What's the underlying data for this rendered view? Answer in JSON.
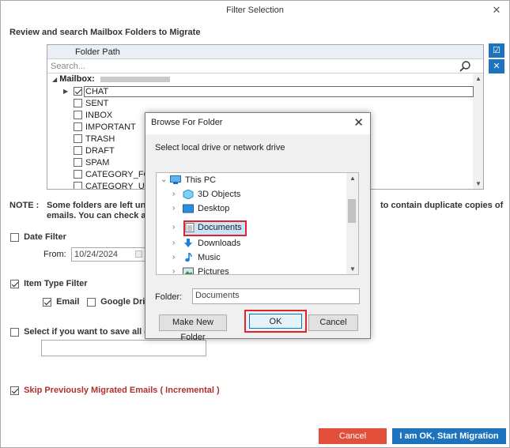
{
  "window": {
    "title": "Filter Selection",
    "close_glyph": "✕"
  },
  "section_title": "Review and search Mailbox Folders to Migrate",
  "tree": {
    "header": "Folder Path",
    "search_placeholder": "Search...",
    "mailbox_label": "Mailbox:",
    "folders": [
      {
        "name": "CHAT",
        "checked": true,
        "expandable": true
      },
      {
        "name": "SENT",
        "checked": false
      },
      {
        "name": "INBOX",
        "checked": false
      },
      {
        "name": "IMPORTANT",
        "checked": false
      },
      {
        "name": "TRASH",
        "checked": false
      },
      {
        "name": "DRAFT",
        "checked": false
      },
      {
        "name": "SPAM",
        "checked": false
      },
      {
        "name": "CATEGORY_FOR",
        "checked": false
      },
      {
        "name": "CATEGORY_UPD",
        "checked": false
      }
    ]
  },
  "side_buttons": {
    "check_all": "☑",
    "uncheck_all": "✕"
  },
  "note": {
    "label": "NOTE :",
    "line1_start": "Some folders are left unche",
    "line1_end": "to contain duplicate copies of",
    "line2": "emails. You can check and i"
  },
  "date_filter": {
    "label": "Date Filter",
    "checked": false,
    "from_label": "From:",
    "from_value": "10/24/2024"
  },
  "item_type_filter": {
    "label": "Item Type Filter",
    "checked": true,
    "email_label": "Email",
    "email_checked": true,
    "drive_label": "Google Drive",
    "drive_checked": false
  },
  "save_all": {
    "label": "Select if you want to save all data",
    "checked": false,
    "value": ""
  },
  "skip": {
    "label": "Skip Previously Migrated Emails ( Incremental )",
    "checked": true
  },
  "footer": {
    "cancel_label": "Cancel",
    "start_label": "I am OK, Start Migration"
  },
  "dialog": {
    "title": "Browse For Folder",
    "close_glyph": "✕",
    "subtitle": "Select local drive or network drive",
    "items": [
      {
        "label": "This PC",
        "icon": "this-pc-icon",
        "expanded": true,
        "level": 0
      },
      {
        "label": "3D Objects",
        "icon": "3d-objects-icon",
        "level": 1
      },
      {
        "label": "Desktop",
        "icon": "desktop-icon",
        "level": 1
      },
      {
        "label": "Documents",
        "icon": "documents-icon",
        "level": 1,
        "selected": true
      },
      {
        "label": "Downloads",
        "icon": "downloads-icon",
        "level": 1
      },
      {
        "label": "Music",
        "icon": "music-icon",
        "level": 1
      },
      {
        "label": "Pictures",
        "icon": "pictures-icon",
        "level": 1
      }
    ],
    "folder_label": "Folder:",
    "folder_value": "Documents",
    "make_new_folder": "Make New Folder",
    "ok": "OK",
    "cancel": "Cancel"
  },
  "colors": {
    "accent_blue": "#1e73be",
    "cancel_red": "#e14f3a",
    "highlight_red": "#e0242d",
    "skip_text": "#b0302a"
  }
}
